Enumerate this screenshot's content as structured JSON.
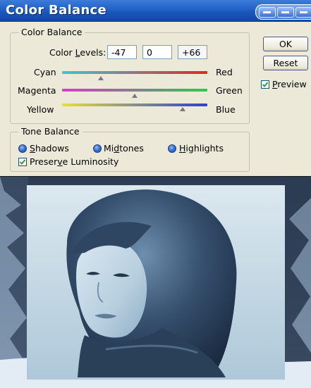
{
  "window": {
    "title": "Color Balance"
  },
  "color_balance": {
    "group_label": "Color Balance",
    "levels_label": "Color Levels:",
    "levels": [
      "-47",
      "0",
      "+66"
    ],
    "sliders": [
      {
        "left": "Cyan",
        "right": "Red",
        "value": -47,
        "colors": [
          "#38c7d6",
          "#e52626"
        ]
      },
      {
        "left": "Magenta",
        "right": "Green",
        "value": 0,
        "colors": [
          "#d63ad0",
          "#2ec94a"
        ]
      },
      {
        "left": "Yellow",
        "right": "Blue",
        "value": 66,
        "colors": [
          "#e8e032",
          "#2b3fd8"
        ]
      }
    ],
    "slider_range": [
      -100,
      100
    ]
  },
  "tone_balance": {
    "group_label": "Tone Balance",
    "shadows": "Shadows",
    "midtones": "Midtones",
    "highlights": "Highlights",
    "selected": "Midtones",
    "preserve_luminosity": "Preserve Luminosity",
    "preserve_checked": true
  },
  "buttons": {
    "ok": "OK",
    "reset": "Reset"
  },
  "preview": {
    "label": "Preview",
    "checked": true
  },
  "colors": {
    "titlebar": "#2463c8",
    "dialog_bg": "#ece9d8",
    "photo_tint": "#7fa7c4"
  }
}
